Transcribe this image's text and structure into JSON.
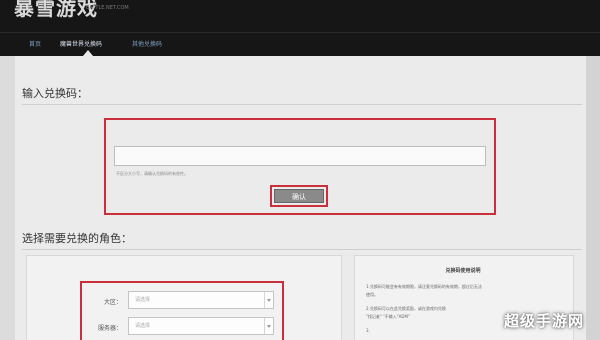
{
  "header": {
    "logo": "暴雪游戏",
    "logo_sub": "BATTLE.NET.COM",
    "nav": [
      "首页",
      "魔兽世界兑换码",
      "其他兑换码"
    ]
  },
  "redeem": {
    "section_title": "输入兑换码：",
    "input_value": "",
    "hint": "不区分大小写，请确认兑换码的有效性。",
    "confirm_label": "确认"
  },
  "character": {
    "section_title": "选择需要兑换的角色：",
    "fields": [
      {
        "label": "大区：",
        "value": "请选择"
      },
      {
        "label": "服务器：",
        "value": "请选择"
      }
    ]
  },
  "tips": {
    "title": "兑换码使用说明",
    "lines": [
      "1.兑换码可能会有有效期限，请注意兑换码的有效期，超过后无法",
      "使用。",
      "2.兑换码可以在此兑换奖励，或在游戏内兑换",
      "\"找记者\" \"不输入\"ADM\"",
      "3."
    ]
  },
  "watermark": "超级手游网"
}
